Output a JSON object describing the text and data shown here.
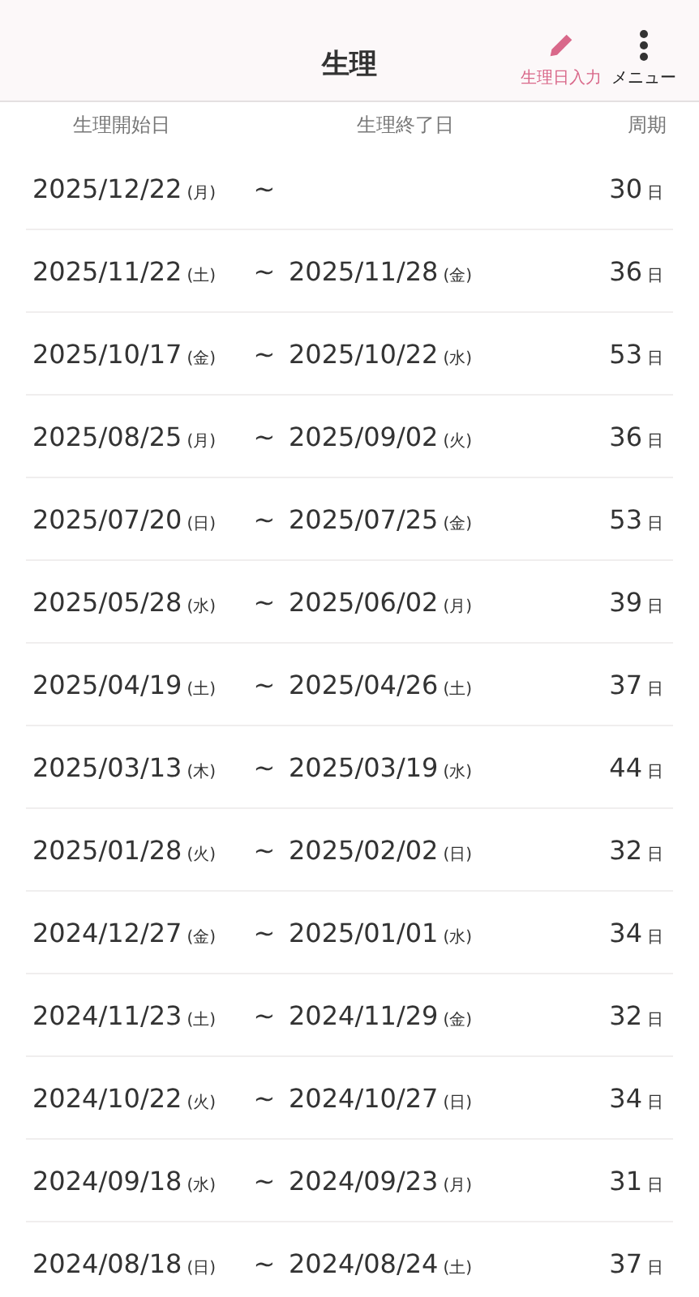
{
  "header": {
    "title": "生理",
    "actions": [
      {
        "kind": "pencil",
        "label": "生理日入力"
      },
      {
        "kind": "menu",
        "label": "メニュー"
      }
    ]
  },
  "columns": [
    "生理開始日",
    "生理終了日",
    "周期"
  ],
  "rows": [
    {
      "start": "2025/12/22",
      "start_weekday": "(月)",
      "separator": "~",
      "cycle": "30",
      "cycle_unit": "日"
    },
    {
      "start": "2025/11/22",
      "start_weekday": "(土)",
      "separator": "~",
      "end": "2025/11/28",
      "end_weekday": "(金)",
      "cycle": "36",
      "cycle_unit": "日"
    },
    {
      "start": "2025/10/17",
      "start_weekday": "(金)",
      "separator": "~",
      "end": "2025/10/22",
      "end_weekday": "(水)",
      "cycle": "53",
      "cycle_unit": "日"
    },
    {
      "start": "2025/08/25",
      "start_weekday": "(月)",
      "separator": "~",
      "end": "2025/09/02",
      "end_weekday": "(火)",
      "cycle": "36",
      "cycle_unit": "日"
    },
    {
      "start": "2025/07/20",
      "start_weekday": "(日)",
      "separator": "~",
      "end": "2025/07/25",
      "end_weekday": "(金)",
      "cycle": "53",
      "cycle_unit": "日"
    },
    {
      "start": "2025/05/28",
      "start_weekday": "(水)",
      "separator": "~",
      "end": "2025/06/02",
      "end_weekday": "(月)",
      "cycle": "39",
      "cycle_unit": "日"
    },
    {
      "start": "2025/04/19",
      "start_weekday": "(土)",
      "separator": "~",
      "end": "2025/04/26",
      "end_weekday": "(土)",
      "cycle": "37",
      "cycle_unit": "日"
    },
    {
      "start": "2025/03/13",
      "start_weekday": "(木)",
      "separator": "~",
      "end": "2025/03/19",
      "end_weekday": "(水)",
      "cycle": "44",
      "cycle_unit": "日"
    },
    {
      "start": "2025/01/28",
      "start_weekday": "(火)",
      "separator": "~",
      "end": "2025/02/02",
      "end_weekday": "(日)",
      "cycle": "32",
      "cycle_unit": "日"
    },
    {
      "start": "2024/12/27",
      "start_weekday": "(金)",
      "separator": "~",
      "end": "2025/01/01",
      "end_weekday": "(水)",
      "cycle": "34",
      "cycle_unit": "日"
    },
    {
      "start": "2024/11/23",
      "start_weekday": "(土)",
      "separator": "~",
      "end": "2024/11/29",
      "end_weekday": "(金)",
      "cycle": "32",
      "cycle_unit": "日"
    },
    {
      "start": "2024/10/22",
      "start_weekday": "(火)",
      "separator": "~",
      "end": "2024/10/27",
      "end_weekday": "(日)",
      "cycle": "34",
      "cycle_unit": "日"
    },
    {
      "start": "2024/09/18",
      "start_weekday": "(水)",
      "separator": "~",
      "end": "2024/09/23",
      "end_weekday": "(月)",
      "cycle": "31",
      "cycle_unit": "日"
    },
    {
      "start": "2024/08/18",
      "start_weekday": "(日)",
      "separator": "~",
      "end": "2024/08/24",
      "end_weekday": "(土)",
      "cycle": "37",
      "cycle_unit": "日"
    }
  ]
}
